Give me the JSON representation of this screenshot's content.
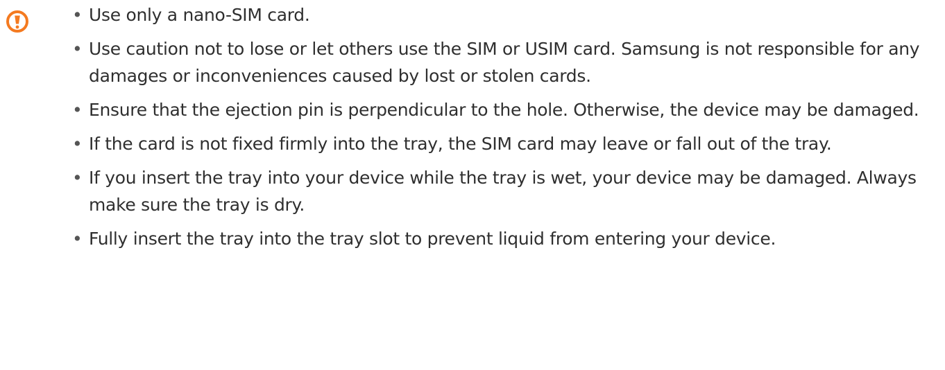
{
  "icon": {
    "name": "caution-icon",
    "color": "#f47a20",
    "glyph": "!"
  },
  "bullets": [
    "Use only a nano-SIM card.",
    "Use caution not to lose or let others use the SIM or USIM card. Samsung is not responsible for any damages or inconveniences caused by lost or stolen cards.",
    "Ensure that the ejection pin is perpendicular to the hole. Otherwise, the device may be damaged.",
    "If the card is not fixed firmly into the tray, the SIM card may leave or fall out of the tray.",
    "If you insert the tray into your device while the tray is wet, your device may be damaged. Always make sure the tray is dry.",
    "Fully insert the tray into the tray slot to prevent liquid from entering your device."
  ]
}
